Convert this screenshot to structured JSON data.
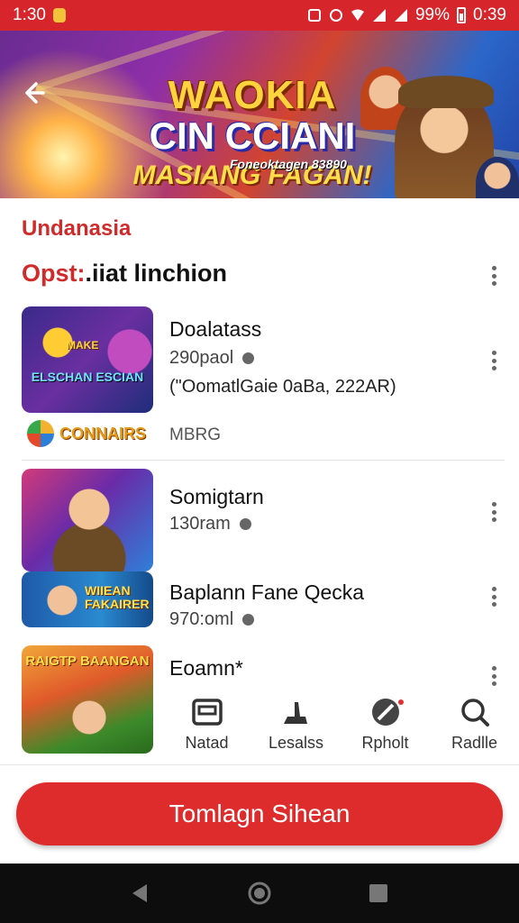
{
  "status_bar": {
    "time_left": "1:30",
    "battery": "99%",
    "time_right": "0:39"
  },
  "banner": {
    "line1": "WAOKIA",
    "line2": "CIN CCIANI",
    "line3": "MASIANG FAGAN!",
    "subtitle": "Foneoktagen 83890"
  },
  "section": {
    "label": "Undanasia",
    "title_red": "Opst:",
    "title_black": ".iiat linchion"
  },
  "items": [
    {
      "title": "Doalatass",
      "meta": "290paol",
      "extra": "(\"OomatlGaie 0aBa, 222AR)",
      "thumb_text1": "MAKE",
      "thumb_text2": "ELSCHAN ESCIAN"
    },
    {
      "title": "Somigtarn",
      "meta": "130ram"
    },
    {
      "title": "Baplann Fane Qecka",
      "meta": "970:oml",
      "thumb_text": "WIIEAN FAKAIRER"
    },
    {
      "title": "Eoamn*",
      "thumb_text": "RAIGTP BAANGAN"
    }
  ],
  "brand": {
    "name": "CONNAIRS",
    "meta": "MBRG"
  },
  "bottom_nav": [
    {
      "label": "Natad",
      "icon": "window-icon"
    },
    {
      "label": "Lesalss",
      "icon": "hand-icon"
    },
    {
      "label": "Rpholt",
      "icon": "compass-icon"
    },
    {
      "label": "Radlle",
      "icon": "search-icon"
    }
  ],
  "cta": {
    "label": "Tomlagn Sihean"
  },
  "colors": {
    "accent_red": "#d6252b",
    "cta_red": "#de2b2b"
  }
}
